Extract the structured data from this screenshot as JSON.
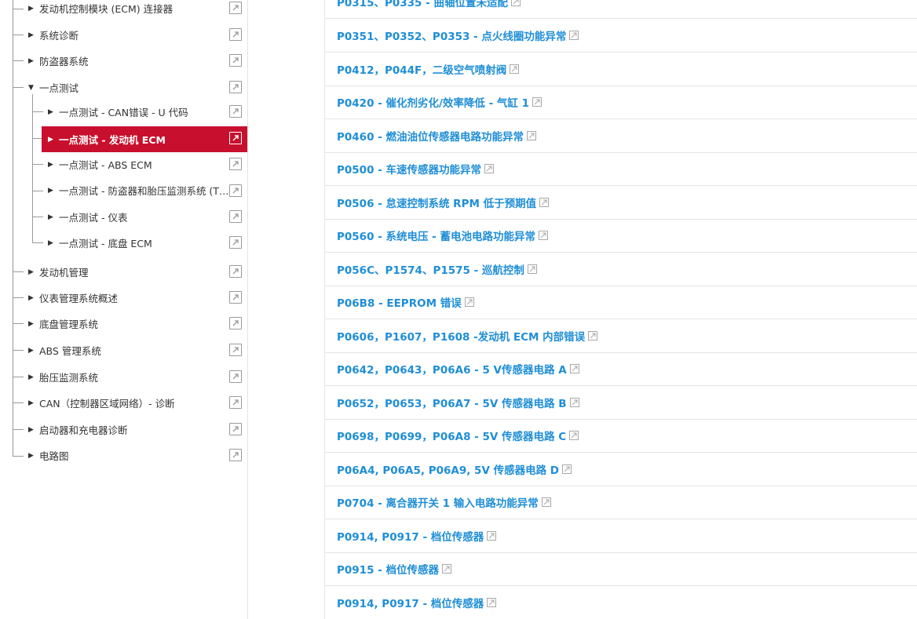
{
  "tree": {
    "items": [
      {
        "label": "发动机控制模块 (ECM) 连接器",
        "arrow": "▶"
      },
      {
        "label": "系统诊断",
        "arrow": "▶"
      },
      {
        "label": "防盗器系统",
        "arrow": "▶"
      },
      {
        "label": "一点测试",
        "arrow": "▼"
      },
      {
        "label": "一点测试 - CAN错误 - U 代码",
        "arrow": "▶"
      },
      {
        "label": "一点测试 - 发动机 ECM",
        "arrow": "▶"
      },
      {
        "label": "一点测试 - ABS ECM",
        "arrow": "▶"
      },
      {
        "label": "一点测试 - 防盗器和胎压监测系统 (TPMS) ECM",
        "arrow": "▶"
      },
      {
        "label": "一点测试 - 仪表",
        "arrow": "▶"
      },
      {
        "label": "一点测试 - 底盘 ECM",
        "arrow": "▶"
      },
      {
        "label": "发动机管理",
        "arrow": "▶"
      },
      {
        "label": "仪表管理系统概述",
        "arrow": "▶"
      },
      {
        "label": "底盘管理系统",
        "arrow": "▶"
      },
      {
        "label": "ABS 管理系统",
        "arrow": "▶"
      },
      {
        "label": "胎压监测系统",
        "arrow": "▶"
      },
      {
        "label": "CAN（控制器区域网络）- 诊断",
        "arrow": "▶"
      },
      {
        "label": "启动器和充电器诊断",
        "arrow": "▶"
      },
      {
        "label": "电路图",
        "arrow": "▶"
      }
    ]
  },
  "list": {
    "items": [
      "P0315、P0335 - 曲轴位置未适配",
      "P0351、P0352、P0353 - 点火线圈功能异常",
      "P0412，P044F，二级空气喷射阀",
      "P0420 - 催化剂劣化/效率降低 - 气缸 1",
      "P0460 - 燃油油位传感器电路功能异常",
      "P0500 - 车速传感器功能异常",
      "P0506 - 怠速控制系统 RPM 低于预期值",
      "P0560 - 系统电压 - 蓄电池电路功能异常",
      "P056C、P1574、P1575 - 巡航控制",
      "P06B8 - EEPROM 错误",
      "P0606，P1607，P1608 -发动机 ECM 内部错误",
      "P0642，P0643，P06A6 - 5 V传感器电路 A",
      "P0652，P0653，P06A7 - 5V 传感器电路 B",
      "P0698，P0699，P06A8 - 5V 传感器电路 C",
      "P06A4, P06A5, P06A9, 5V 传感器电路 D",
      "P0704 - 离合器开关 1 输入电路功能异常",
      "P0914, P0917 - 档位传感器",
      "P0915 - 档位传感器",
      "P0914, P0917 - 档位传感器"
    ]
  }
}
